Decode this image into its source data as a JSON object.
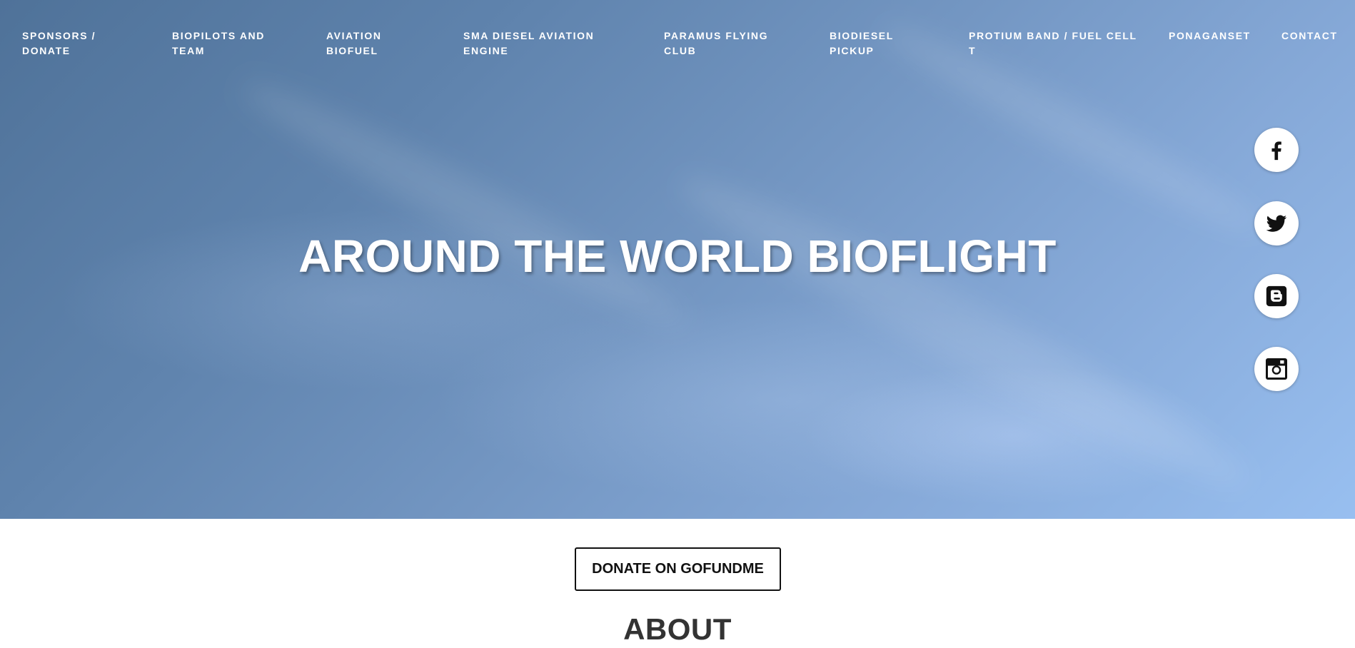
{
  "nav": {
    "items": [
      {
        "line1": "SPONSORS /",
        "line2": "DONATE"
      },
      {
        "line1": "BIOPILOTS AND",
        "line2": "TEAM"
      },
      {
        "line1": "AVIATION",
        "line2": "BIOFUEL"
      },
      {
        "line1": "SMA DIESEL AVIATION",
        "line2": "ENGINE"
      },
      {
        "line1": "PARAMUS FLYING",
        "line2": "CLUB"
      },
      {
        "line1": "BIODIESEL",
        "line2": "PICKUP"
      },
      {
        "line1": "PROTIUM BAND / FUEL CELL",
        "line2": "T"
      },
      {
        "line1": "PONAGANSET",
        "line2": ""
      },
      {
        "line1": "CONTACT",
        "line2": ""
      }
    ]
  },
  "hero": {
    "title": "AROUND THE WORLD BIOFLIGHT"
  },
  "social": {
    "icons": [
      "facebook-icon",
      "twitter-icon",
      "blogger-icon",
      "instagram-icon"
    ]
  },
  "donate": {
    "label": "DONATE ON GOFUNDME"
  },
  "about": {
    "heading": "ABOUT"
  },
  "colors": {
    "sky_top": "#4f7299",
    "sky_bottom": "#98bff0",
    "text_light": "#ffffff",
    "text_dark": "#111111"
  }
}
